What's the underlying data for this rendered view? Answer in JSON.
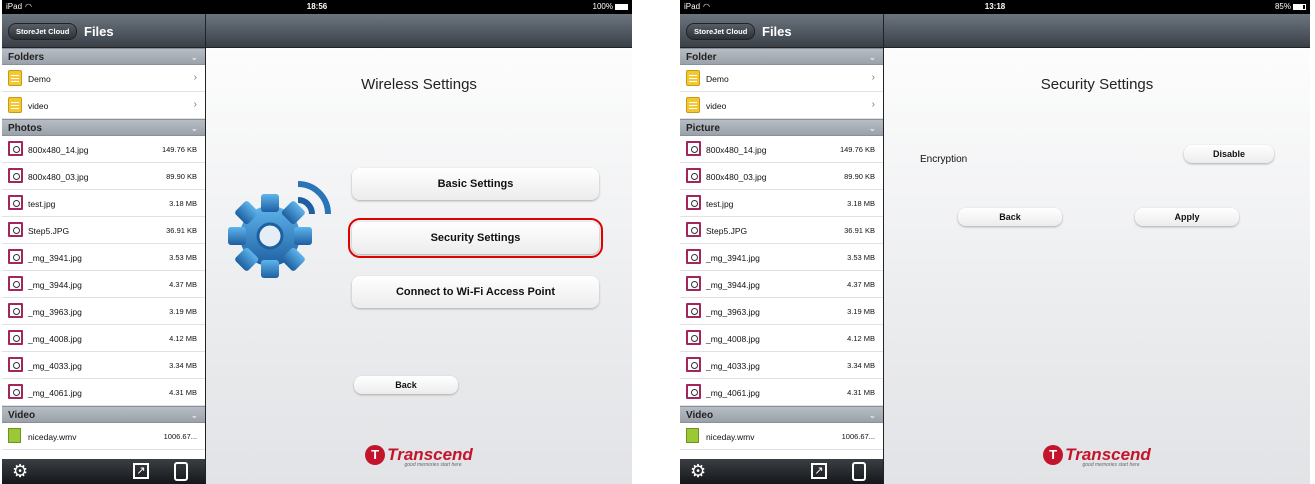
{
  "screens": [
    {
      "status": {
        "carrier": "iPad",
        "time": "18:56",
        "battery": "100%",
        "battery_fraction": 1.0
      },
      "left": {
        "back_button": "StoreJet Cloud",
        "title": "Files",
        "sections": [
          {
            "title": "Folders",
            "type": "folder",
            "items": [
              {
                "name": "Demo"
              },
              {
                "name": "video"
              }
            ]
          },
          {
            "title": "Photos",
            "type": "photo",
            "items": [
              {
                "name": "800x480_14.jpg",
                "size": "149.76 KB"
              },
              {
                "name": "800x480_03.jpg",
                "size": "89.90 KB"
              },
              {
                "name": "test.jpg",
                "size": "3.18 MB"
              },
              {
                "name": "Step5.JPG",
                "size": "36.91 KB"
              },
              {
                "name": "_mg_3941.jpg",
                "size": "3.53 MB"
              },
              {
                "name": "_mg_3944.jpg",
                "size": "4.37 MB"
              },
              {
                "name": "_mg_3963.jpg",
                "size": "3.19 MB"
              },
              {
                "name": "_mg_4008.jpg",
                "size": "4.12 MB"
              },
              {
                "name": "_mg_4033.jpg",
                "size": "3.34 MB"
              },
              {
                "name": "_mg_4061.jpg",
                "size": "4.31 MB"
              }
            ]
          },
          {
            "title": "Video",
            "type": "video",
            "items": [
              {
                "name": "niceday.wmv",
                "size": "1006.67..."
              }
            ]
          }
        ]
      },
      "main": {
        "title": "Wireless Settings",
        "buttons": [
          "Basic Settings",
          "Security Settings",
          "Connect to Wi-Fi Access Point"
        ],
        "selected_button": "Security Settings",
        "back": "Back"
      }
    },
    {
      "status": {
        "carrier": "iPad",
        "time": "13:18",
        "battery": "85%",
        "battery_fraction": 0.85
      },
      "left": {
        "back_button": "StoreJet Cloud",
        "title": "Files",
        "sections": [
          {
            "title": "Folder",
            "type": "folder",
            "items": [
              {
                "name": "Demo"
              },
              {
                "name": "video"
              }
            ]
          },
          {
            "title": "Picture",
            "type": "photo",
            "items": [
              {
                "name": "800x480_14.jpg",
                "size": "149.76 KB"
              },
              {
                "name": "800x480_03.jpg",
                "size": "89.90 KB"
              },
              {
                "name": "test.jpg",
                "size": "3.18 MB"
              },
              {
                "name": "Step5.JPG",
                "size": "36.91 KB"
              },
              {
                "name": "_mg_3941.jpg",
                "size": "3.53 MB"
              },
              {
                "name": "_mg_3944.jpg",
                "size": "4.37 MB"
              },
              {
                "name": "_mg_3963.jpg",
                "size": "3.19 MB"
              },
              {
                "name": "_mg_4008.jpg",
                "size": "4.12 MB"
              },
              {
                "name": "_mg_4033.jpg",
                "size": "3.34 MB"
              },
              {
                "name": "_mg_4061.jpg",
                "size": "4.31 MB"
              }
            ]
          },
          {
            "title": "Video",
            "type": "video",
            "items": [
              {
                "name": "niceday.wmv",
                "size": "1006.67..."
              }
            ]
          }
        ]
      },
      "main": {
        "title": "Security Settings",
        "encryption_label": "Encryption",
        "encryption_value": "Disable",
        "back": "Back",
        "apply": "Apply"
      }
    }
  ],
  "branding": {
    "logo_text": "Transcend",
    "tagline": "good memories start here"
  },
  "colors": {
    "accent_red": "#c4142c",
    "selection_outline": "#e00000",
    "header_dark": "#3a4048"
  },
  "icons": {
    "settings": "gear-icon",
    "upload": "upload-icon",
    "device": "device-icon",
    "chevron": "chevron-right-icon"
  }
}
